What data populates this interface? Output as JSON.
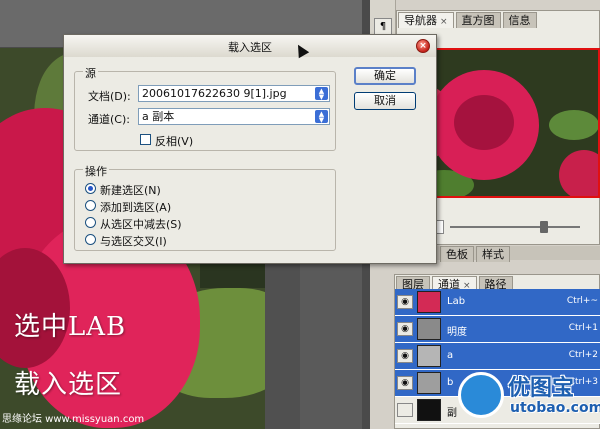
{
  "dialog": {
    "title": "载入选区",
    "source_group": {
      "legend": "源",
      "document_label": "文档(D):",
      "document_value": "20061017622630 9[1].jpg",
      "channel_label": "通道(C):",
      "channel_value": "a 副本",
      "invert_label": "反相(V)",
      "invert_checked": false
    },
    "operation_group": {
      "legend": "操作",
      "options": [
        {
          "label": "新建选区(N)",
          "selected": true
        },
        {
          "label": "添加到选区(A)",
          "selected": false
        },
        {
          "label": "从选区中减去(S)",
          "selected": false
        },
        {
          "label": "与选区交叉(I)",
          "selected": false
        }
      ]
    },
    "ok_label": "确定",
    "cancel_label": "取消"
  },
  "navigator": {
    "tabs": [
      {
        "label": "导航器",
        "active": true,
        "closable": true
      },
      {
        "label": "直方图",
        "active": false,
        "closable": false
      },
      {
        "label": "信息",
        "active": false,
        "closable": false
      }
    ]
  },
  "color_panel": {
    "tabs": [
      {
        "label": "色板",
        "active": false
      },
      {
        "label": "样式",
        "active": false
      }
    ]
  },
  "layers_panel": {
    "tabs": [
      {
        "label": "图层",
        "active": false,
        "closable": false
      },
      {
        "label": "通道",
        "active": true,
        "closable": true
      },
      {
        "label": "路径",
        "active": false,
        "closable": false
      }
    ],
    "channels": [
      {
        "name": "Lab",
        "shortcut": "Ctrl+~",
        "selected": true
      },
      {
        "name": "明度",
        "shortcut": "Ctrl+1",
        "selected": true
      },
      {
        "name": "a",
        "shortcut": "Ctrl+2",
        "selected": true
      },
      {
        "name": "b",
        "shortcut": "Ctrl+3",
        "selected": true
      },
      {
        "name": "副",
        "shortcut": "",
        "selected": false
      }
    ]
  },
  "canvas_text": {
    "line1": "选中LAB",
    "line2": "载入选区"
  },
  "watermark": "思缘论坛 www.missyuan.com",
  "logo": {
    "name": "优图宝",
    "url": "utobao.com"
  },
  "colors": {
    "selection_blue": "#3168c6",
    "dialog_bg": "#ecebe4",
    "accent_red": "#e01010"
  }
}
